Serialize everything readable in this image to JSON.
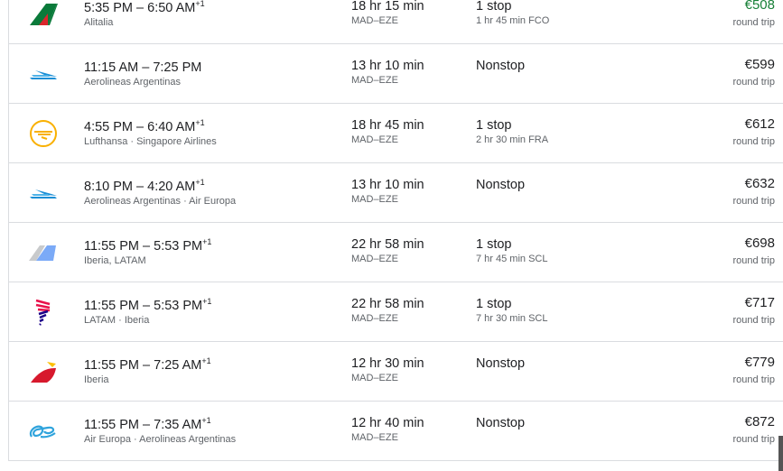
{
  "flights": [
    {
      "logo": "alitalia-logo",
      "depart": "5:35 PM",
      "arrive": "6:50 AM",
      "day_offset": "+1",
      "airlines": "Alitalia",
      "duration": "18 hr 15 min",
      "route": "MAD–EZE",
      "stops": "1 stop",
      "layover": "1 hr 45 min FCO",
      "price": "€508",
      "price_type": "round trip",
      "best": true
    },
    {
      "logo": "aerolineas-argentinas-logo",
      "depart": "11:15 AM",
      "arrive": "7:25 PM",
      "day_offset": "",
      "airlines": "Aerolineas Argentinas",
      "duration": "13 hr 10 min",
      "route": "MAD–EZE",
      "stops": "Nonstop",
      "layover": "",
      "price": "€599",
      "price_type": "round trip"
    },
    {
      "logo": "lufthansa-logo",
      "depart": "4:55 PM",
      "arrive": "6:40 AM",
      "day_offset": "+1",
      "airlines": "Lufthansa · Singapore Airlines",
      "duration": "18 hr 45 min",
      "route": "MAD–EZE",
      "stops": "1 stop",
      "layover": "2 hr 30 min FRA",
      "price": "€612",
      "price_type": "round trip"
    },
    {
      "logo": "aerolineas-argentinas-logo",
      "depart": "8:10 PM",
      "arrive": "4:20 AM",
      "day_offset": "+1",
      "airlines": "Aerolineas Argentinas · Air Europa",
      "duration": "13 hr 10 min",
      "route": "MAD–EZE",
      "stops": "Nonstop",
      "layover": "",
      "price": "€632",
      "price_type": "round trip"
    },
    {
      "logo": "multi-airline-logo",
      "depart": "11:55 PM",
      "arrive": "5:53 PM",
      "day_offset": "+1",
      "airlines": "Iberia, LATAM",
      "duration": "22 hr 58 min",
      "route": "MAD–EZE",
      "stops": "1 stop",
      "layover": "7 hr 45 min SCL",
      "price": "€698",
      "price_type": "round trip"
    },
    {
      "logo": "latam-logo",
      "depart": "11:55 PM",
      "arrive": "5:53 PM",
      "day_offset": "+1",
      "airlines": "LATAM · Iberia",
      "duration": "22 hr 58 min",
      "route": "MAD–EZE",
      "stops": "1 stop",
      "layover": "7 hr 30 min SCL",
      "price": "€717",
      "price_type": "round trip"
    },
    {
      "logo": "iberia-logo",
      "depart": "11:55 PM",
      "arrive": "7:25 AM",
      "day_offset": "+1",
      "airlines": "Iberia",
      "duration": "12 hr 30 min",
      "route": "MAD–EZE",
      "stops": "Nonstop",
      "layover": "",
      "price": "€779",
      "price_type": "round trip"
    },
    {
      "logo": "air-europa-logo",
      "depart": "11:55 PM",
      "arrive": "7:35 AM",
      "day_offset": "+1",
      "airlines": "Air Europa · Aerolineas Argentinas",
      "duration": "12 hr 40 min",
      "route": "MAD–EZE",
      "stops": "Nonstop",
      "layover": "",
      "price": "€872",
      "price_type": "round trip"
    }
  ],
  "colors": {
    "best_price": "#188038",
    "text": "#202124",
    "secondary": "#5f6368",
    "divider": "#dadce0"
  }
}
